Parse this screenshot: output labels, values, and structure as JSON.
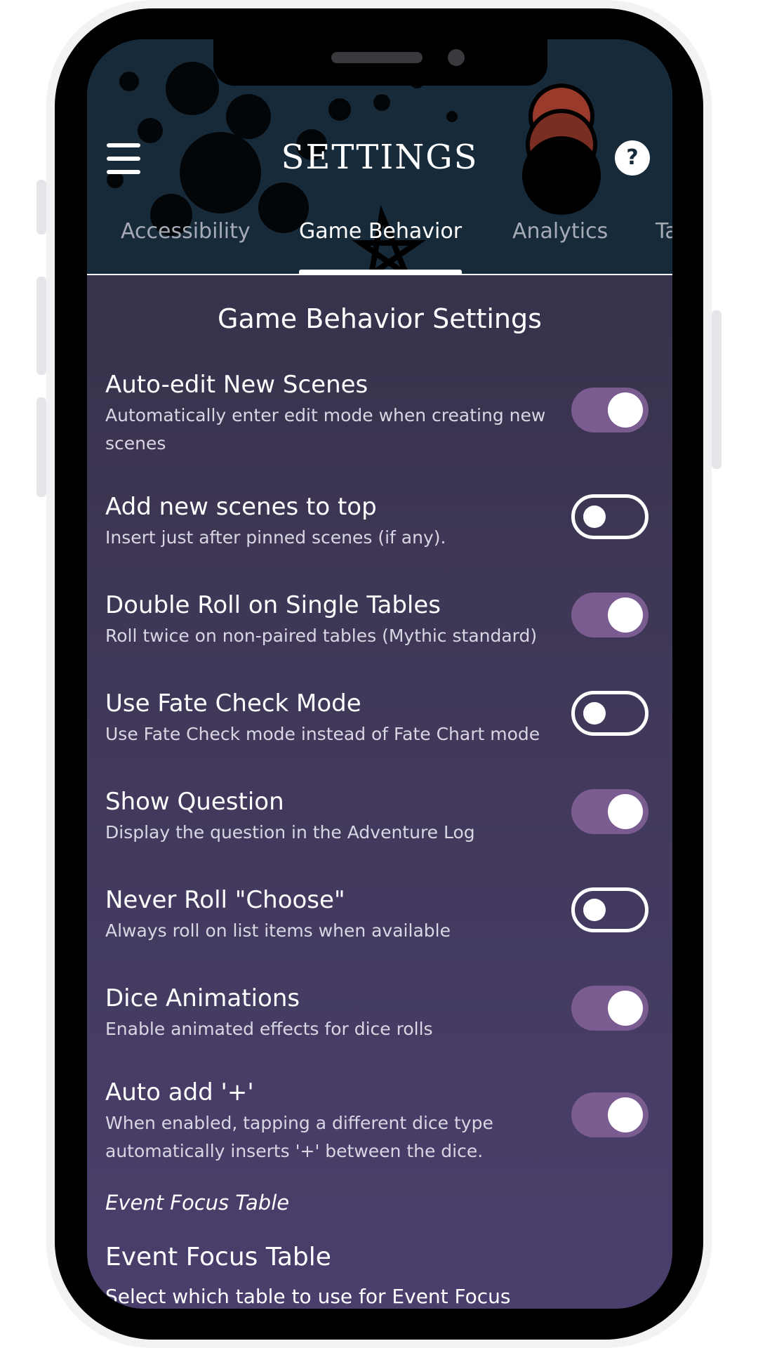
{
  "app": {
    "title": "SETTINGS",
    "help_label": "?"
  },
  "tabs": [
    {
      "label": "Accessibility",
      "active": false
    },
    {
      "label": "Game Behavior",
      "active": true
    },
    {
      "label": "Analytics",
      "active": false
    },
    {
      "label": "Ta",
      "active": false
    }
  ],
  "section_title": "Game Behavior Settings",
  "settings": [
    {
      "title": "Auto-edit New Scenes",
      "description": "Automatically enter edit mode when creating new scenes",
      "enabled": true
    },
    {
      "title": "Add new scenes to top",
      "description": "Insert just after pinned scenes (if any).",
      "enabled": false
    },
    {
      "title": "Double Roll on Single Tables",
      "description": "Roll twice on non-paired tables (Mythic standard)",
      "enabled": true
    },
    {
      "title": "Use Fate Check Mode",
      "description": "Use Fate Check mode instead of Fate Chart mode",
      "enabled": false
    },
    {
      "title": "Show Question",
      "description": "Display the question in the Adventure Log",
      "enabled": true
    },
    {
      "title": "Never Roll \"Choose\"",
      "description": "Always roll on list items when available",
      "enabled": false
    },
    {
      "title": "Dice Animations",
      "description": "Enable animated effects for dice rolls",
      "enabled": true
    },
    {
      "title": "Auto add '+'",
      "description": "When enabled, tapping a different dice type automatically inserts '+' between the dice.",
      "enabled": true
    }
  ],
  "event_focus": {
    "subheader": "Event Focus Table",
    "title": "Event Focus Table",
    "description": "Select which table to use for Event Focus"
  },
  "colors": {
    "header_bg": "#172a3a",
    "toggle_on": "#7a5c90",
    "screen_top": "#332e44",
    "screen_bottom": "#4a3f6c"
  },
  "icons": [
    "menu-icon",
    "help-icon"
  ]
}
